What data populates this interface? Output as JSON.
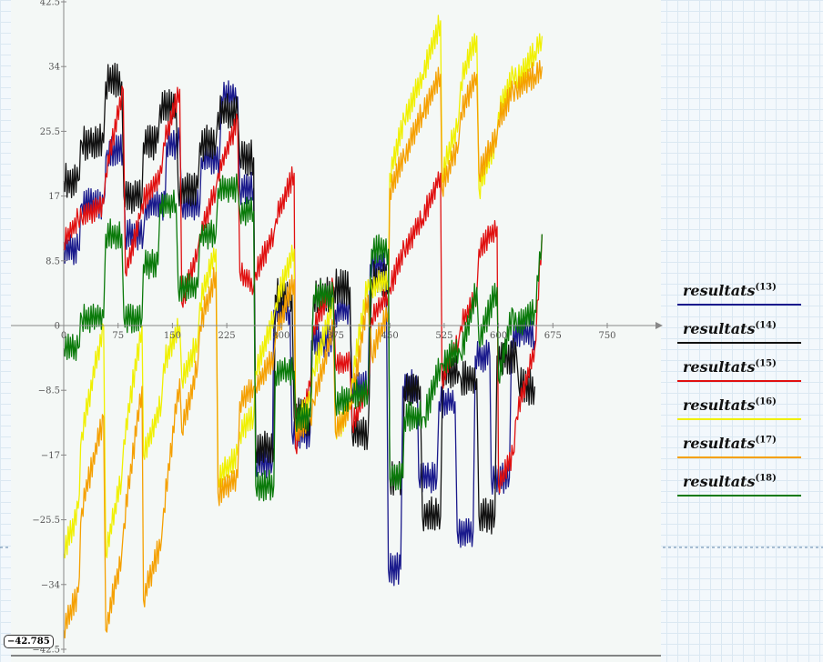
{
  "colors": {
    "axis": "#888888",
    "plot_background": "#f4f8f6"
  },
  "cursor_readout": "−42.785",
  "legend": [
    {
      "name": "resultats",
      "superscript": "(13)",
      "color": "#1a1a8c"
    },
    {
      "name": "resultats",
      "superscript": "(14)",
      "color": "#111111"
    },
    {
      "name": "resultats",
      "superscript": "(15)",
      "color": "#e01010"
    },
    {
      "name": "resultats",
      "superscript": "(16)",
      "color": "#f0f000"
    },
    {
      "name": "resultats",
      "superscript": "(17)",
      "color": "#f5a000"
    },
    {
      "name": "resultats",
      "superscript": "(18)",
      "color": "#0a7a0a"
    }
  ],
  "chart_data": {
    "type": "line",
    "title": "",
    "xlabel": "",
    "ylabel": "",
    "xlim": [
      0,
      750
    ],
    "ylim": [
      -42.5,
      42.5
    ],
    "x_ticks": [
      0,
      75,
      150,
      225,
      300,
      375,
      450,
      525,
      600,
      675,
      750
    ],
    "x_tick_labels": [
      "0",
      "75",
      "150",
      "225",
      "300",
      "375",
      "450",
      "525",
      "600",
      "675",
      "750"
    ],
    "y_ticks": [
      42.5,
      34,
      25.5,
      17,
      8.5,
      0,
      -8.5,
      -17,
      -25.5,
      -34,
      -42.5
    ],
    "y_tick_labels": [
      "42.5",
      "34",
      "25.5",
      "17",
      "8.5",
      "0",
      "−8.5",
      "−17",
      "−25.5",
      "−34",
      "−42.5"
    ],
    "grid": false,
    "legend_position": "right",
    "series": [
      {
        "name": "resultats(13)",
        "color": "#1a1a8c",
        "jitter": 2.2,
        "points": [
          [
            0,
            10
          ],
          [
            20,
            10
          ],
          [
            25,
            16
          ],
          [
            55,
            16
          ],
          [
            60,
            23
          ],
          [
            82,
            23
          ],
          [
            85,
            12
          ],
          [
            110,
            12
          ],
          [
            113,
            16
          ],
          [
            140,
            16
          ],
          [
            142,
            24
          ],
          [
            160,
            24
          ],
          [
            163,
            16
          ],
          [
            188,
            16
          ],
          [
            190,
            22
          ],
          [
            215,
            22
          ],
          [
            218,
            30
          ],
          [
            240,
            30
          ],
          [
            243,
            18
          ],
          [
            262,
            18
          ],
          [
            265,
            -18
          ],
          [
            288,
            -18
          ],
          [
            290,
            2
          ],
          [
            312,
            2
          ],
          [
            315,
            -14
          ],
          [
            340,
            -14
          ],
          [
            342,
            -2
          ],
          [
            372,
            -2
          ],
          [
            375,
            2
          ],
          [
            395,
            2
          ],
          [
            398,
            -8
          ],
          [
            420,
            -8
          ],
          [
            423,
            8
          ],
          [
            445,
            8
          ],
          [
            448,
            -32
          ],
          [
            465,
            -32
          ],
          [
            468,
            -8
          ],
          [
            488,
            -8
          ],
          [
            490,
            -20
          ],
          [
            515,
            -20
          ],
          [
            518,
            -10
          ],
          [
            540,
            -10
          ],
          [
            543,
            -27
          ],
          [
            565,
            -27
          ],
          [
            568,
            -4
          ],
          [
            588,
            -4
          ],
          [
            590,
            -20
          ],
          [
            615,
            -20
          ],
          [
            618,
            -2
          ],
          [
            640,
            0
          ],
          [
            650,
            -2
          ]
        ]
      },
      {
        "name": "resultats(14)",
        "color": "#111111",
        "jitter": 2.5,
        "points": [
          [
            0,
            19
          ],
          [
            20,
            19
          ],
          [
            25,
            24
          ],
          [
            55,
            24
          ],
          [
            58,
            32
          ],
          [
            80,
            32
          ],
          [
            83,
            17
          ],
          [
            108,
            17
          ],
          [
            110,
            24
          ],
          [
            130,
            24
          ],
          [
            133,
            29
          ],
          [
            155,
            29
          ],
          [
            158,
            18
          ],
          [
            185,
            18
          ],
          [
            188,
            24
          ],
          [
            210,
            24
          ],
          [
            213,
            28
          ],
          [
            240,
            28
          ],
          [
            243,
            22
          ],
          [
            262,
            22
          ],
          [
            265,
            -16
          ],
          [
            290,
            -16
          ],
          [
            292,
            4
          ],
          [
            315,
            4
          ],
          [
            318,
            -12
          ],
          [
            340,
            -12
          ],
          [
            345,
            4
          ],
          [
            370,
            4
          ],
          [
            373,
            5
          ],
          [
            395,
            5
          ],
          [
            398,
            -14
          ],
          [
            420,
            -14
          ],
          [
            425,
            6
          ],
          [
            448,
            6
          ],
          [
            450,
            -20
          ],
          [
            468,
            -20
          ],
          [
            470,
            -8
          ],
          [
            492,
            -8
          ],
          [
            495,
            -25
          ],
          [
            520,
            -25
          ],
          [
            523,
            -6
          ],
          [
            545,
            -6
          ],
          [
            548,
            -7
          ],
          [
            570,
            -7
          ],
          [
            573,
            -25
          ],
          [
            595,
            -25
          ],
          [
            598,
            -4
          ],
          [
            625,
            -4
          ],
          [
            628,
            -8
          ],
          [
            650,
            -8
          ]
        ]
      },
      {
        "name": "resultats(15)",
        "color": "#e01010",
        "jitter": 1.6,
        "points": [
          [
            0,
            11
          ],
          [
            20,
            14
          ],
          [
            25,
            14
          ],
          [
            55,
            16
          ],
          [
            58,
            20
          ],
          [
            82,
            31
          ],
          [
            85,
            7
          ],
          [
            105,
            14
          ],
          [
            108,
            16
          ],
          [
            135,
            20
          ],
          [
            138,
            24
          ],
          [
            160,
            31
          ],
          [
            163,
            3
          ],
          [
            185,
            10
          ],
          [
            188,
            12
          ],
          [
            210,
            18
          ],
          [
            213,
            20
          ],
          [
            240,
            27
          ],
          [
            243,
            7
          ],
          [
            262,
            5
          ],
          [
            265,
            7
          ],
          [
            290,
            12
          ],
          [
            293,
            14
          ],
          [
            318,
            20
          ],
          [
            320,
            -16
          ],
          [
            340,
            -8
          ],
          [
            345,
            0
          ],
          [
            372,
            5
          ],
          [
            375,
            -5
          ],
          [
            395,
            -5
          ],
          [
            398,
            -13
          ],
          [
            420,
            -8
          ],
          [
            425,
            1
          ],
          [
            448,
            4
          ],
          [
            450,
            5
          ],
          [
            470,
            10
          ],
          [
            495,
            14
          ],
          [
            520,
            20
          ],
          [
            522,
            -7
          ],
          [
            545,
            -2
          ],
          [
            548,
            0
          ],
          [
            570,
            4
          ],
          [
            573,
            10
          ],
          [
            598,
            13
          ],
          [
            600,
            -21
          ],
          [
            620,
            -17
          ],
          [
            625,
            -12
          ],
          [
            650,
            -3
          ],
          [
            660,
            12
          ]
        ]
      },
      {
        "name": "resultats(16)",
        "color": "#f0f000",
        "jitter": 1.8,
        "points": [
          [
            0,
            -30
          ],
          [
            20,
            -24
          ],
          [
            25,
            -14
          ],
          [
            55,
            0
          ],
          [
            58,
            -30
          ],
          [
            80,
            -20
          ],
          [
            83,
            -15
          ],
          [
            108,
            0
          ],
          [
            110,
            -17
          ],
          [
            135,
            -10
          ],
          [
            138,
            -5
          ],
          [
            160,
            0
          ],
          [
            163,
            -7
          ],
          [
            185,
            -2
          ],
          [
            188,
            3
          ],
          [
            210,
            10
          ],
          [
            213,
            -20
          ],
          [
            240,
            -17
          ],
          [
            243,
            -14
          ],
          [
            262,
            -12
          ],
          [
            265,
            -6
          ],
          [
            290,
            1
          ],
          [
            293,
            3
          ],
          [
            318,
            10
          ],
          [
            320,
            -13
          ],
          [
            340,
            -10
          ],
          [
            345,
            -6
          ],
          [
            372,
            3
          ],
          [
            375,
            -14
          ],
          [
            395,
            -11
          ],
          [
            398,
            -7
          ],
          [
            420,
            6
          ],
          [
            425,
            5
          ],
          [
            448,
            6
          ],
          [
            450,
            20
          ],
          [
            470,
            27
          ],
          [
            495,
            33
          ],
          [
            520,
            40
          ],
          [
            522,
            20
          ],
          [
            545,
            27
          ],
          [
            548,
            32
          ],
          [
            570,
            38
          ],
          [
            573,
            18
          ],
          [
            598,
            25
          ],
          [
            600,
            28
          ],
          [
            620,
            33
          ],
          [
            625,
            32
          ],
          [
            650,
            36
          ],
          [
            660,
            38
          ]
        ]
      },
      {
        "name": "resultats(17)",
        "color": "#f5a000",
        "jitter": 1.8,
        "points": [
          [
            0,
            -40
          ],
          [
            20,
            -35
          ],
          [
            25,
            -24
          ],
          [
            55,
            -12
          ],
          [
            58,
            -40
          ],
          [
            80,
            -30
          ],
          [
            83,
            -26
          ],
          [
            108,
            -8
          ],
          [
            110,
            -36
          ],
          [
            135,
            -28
          ],
          [
            138,
            -24
          ],
          [
            160,
            -7
          ],
          [
            163,
            -14
          ],
          [
            185,
            -5
          ],
          [
            188,
            0
          ],
          [
            210,
            7
          ],
          [
            213,
            -22
          ],
          [
            240,
            -20
          ],
          [
            243,
            -10
          ],
          [
            262,
            -8
          ],
          [
            265,
            -8
          ],
          [
            290,
            -4
          ],
          [
            293,
            -1
          ],
          [
            318,
            6
          ],
          [
            320,
            -14
          ],
          [
            340,
            -12
          ],
          [
            345,
            -10
          ],
          [
            372,
            0
          ],
          [
            375,
            -14
          ],
          [
            395,
            -11
          ],
          [
            398,
            -10
          ],
          [
            420,
            4
          ],
          [
            425,
            -4
          ],
          [
            448,
            2
          ],
          [
            450,
            18
          ],
          [
            470,
            22
          ],
          [
            495,
            28
          ],
          [
            520,
            33
          ],
          [
            522,
            18
          ],
          [
            545,
            24
          ],
          [
            548,
            28
          ],
          [
            570,
            33
          ],
          [
            573,
            20
          ],
          [
            598,
            25
          ],
          [
            600,
            27
          ],
          [
            620,
            31
          ],
          [
            625,
            31
          ],
          [
            650,
            33
          ],
          [
            660,
            34
          ]
        ]
      },
      {
        "name": "resultats(18)",
        "color": "#0a7a0a",
        "jitter": 2.0,
        "points": [
          [
            0,
            -3
          ],
          [
            20,
            -3
          ],
          [
            25,
            1
          ],
          [
            55,
            1
          ],
          [
            58,
            12
          ],
          [
            80,
            12
          ],
          [
            83,
            1
          ],
          [
            108,
            1
          ],
          [
            110,
            8
          ],
          [
            130,
            8
          ],
          [
            133,
            16
          ],
          [
            155,
            16
          ],
          [
            158,
            5
          ],
          [
            185,
            5
          ],
          [
            188,
            12
          ],
          [
            210,
            12
          ],
          [
            213,
            18
          ],
          [
            240,
            18
          ],
          [
            243,
            15
          ],
          [
            262,
            15
          ],
          [
            265,
            -21
          ],
          [
            290,
            -21
          ],
          [
            292,
            -6
          ],
          [
            318,
            -6
          ],
          [
            320,
            -12
          ],
          [
            340,
            -12
          ],
          [
            345,
            4
          ],
          [
            372,
            4
          ],
          [
            375,
            -10
          ],
          [
            395,
            -10
          ],
          [
            398,
            -9
          ],
          [
            420,
            -9
          ],
          [
            425,
            10
          ],
          [
            448,
            10
          ],
          [
            450,
            -20
          ],
          [
            468,
            -20
          ],
          [
            470,
            -12
          ],
          [
            495,
            -12
          ],
          [
            498,
            -12
          ],
          [
            520,
            -5
          ],
          [
            523,
            -5
          ],
          [
            545,
            -3
          ],
          [
            548,
            -4
          ],
          [
            570,
            5
          ],
          [
            573,
            -2
          ],
          [
            598,
            5
          ],
          [
            600,
            -7
          ],
          [
            620,
            2
          ],
          [
            625,
            0
          ],
          [
            650,
            2
          ],
          [
            660,
            12
          ]
        ]
      }
    ]
  }
}
